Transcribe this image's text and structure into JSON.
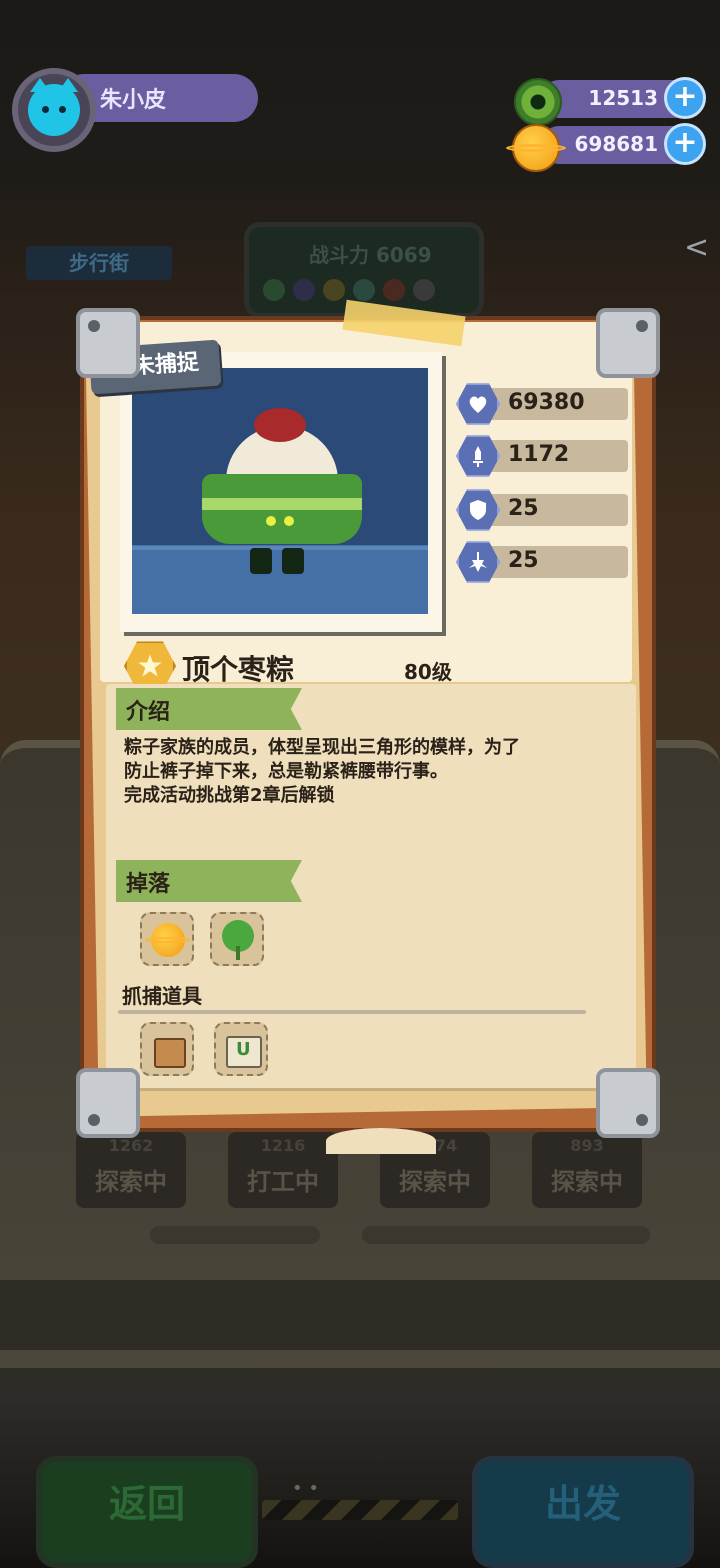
{
  "player": {
    "name": "朱小皮"
  },
  "resources": {
    "gems": "12513",
    "coins": "698681"
  },
  "background": {
    "street": "步行街",
    "power": "战斗力 6069",
    "cards": [
      {
        "count": "1262",
        "status": "探索中"
      },
      {
        "count": "1216",
        "status": "打工中"
      },
      {
        "count": "1074",
        "status": "探索中"
      },
      {
        "count": "893",
        "status": "探索中"
      }
    ],
    "back_label": "返回",
    "go_label": "出发",
    "pager": "• •"
  },
  "card": {
    "tag": "暂未捕捉",
    "monster_name": "顶个枣粽",
    "level": "80级",
    "stats": {
      "hp": "69380",
      "attack": "1172",
      "defense": "25",
      "speed": "25"
    },
    "intro_title": "介绍",
    "intro_lines": [
      "粽子家族的成员，体型呈现出三角形的模样，为了",
      "防止裤子掉下来，总是勒紧裤腰带行事。",
      "完成活动挑战第2章后解锁"
    ],
    "drops_title": "掉落",
    "drops": [
      "coin-icon",
      "herb-icon"
    ],
    "capture_title": "抓捕道具",
    "capture_items": [
      "bag-icon",
      "trap-icon"
    ]
  },
  "colors": {
    "accent": "#6a5ea0",
    "ribbon": "#8fb35a",
    "board": "#b56a38"
  }
}
